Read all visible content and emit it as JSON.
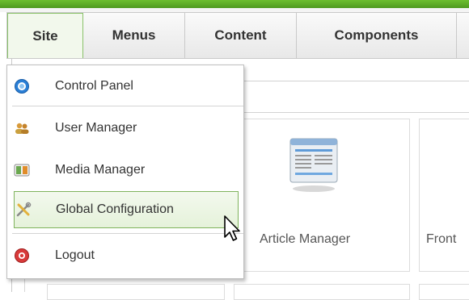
{
  "menubar": {
    "items": [
      {
        "label": "Site",
        "active": true
      },
      {
        "label": "Menus"
      },
      {
        "label": "Content"
      },
      {
        "label": "Components"
      }
    ]
  },
  "dropdown": {
    "items": [
      {
        "label": "Control Panel",
        "icon": "control-panel-icon"
      },
      {
        "label": "User Manager",
        "icon": "users-icon"
      },
      {
        "label": "Media Manager",
        "icon": "media-icon"
      },
      {
        "label": "Global Configuration",
        "icon": "tools-icon",
        "highlighted": true
      },
      {
        "label": "Logout",
        "icon": "logout-icon"
      }
    ]
  },
  "quick_icons": {
    "article_manager": "Article Manager",
    "front_partial": "Front"
  },
  "colors": {
    "top_bar": "#5aab25",
    "highlight_border": "#7fb35c"
  }
}
